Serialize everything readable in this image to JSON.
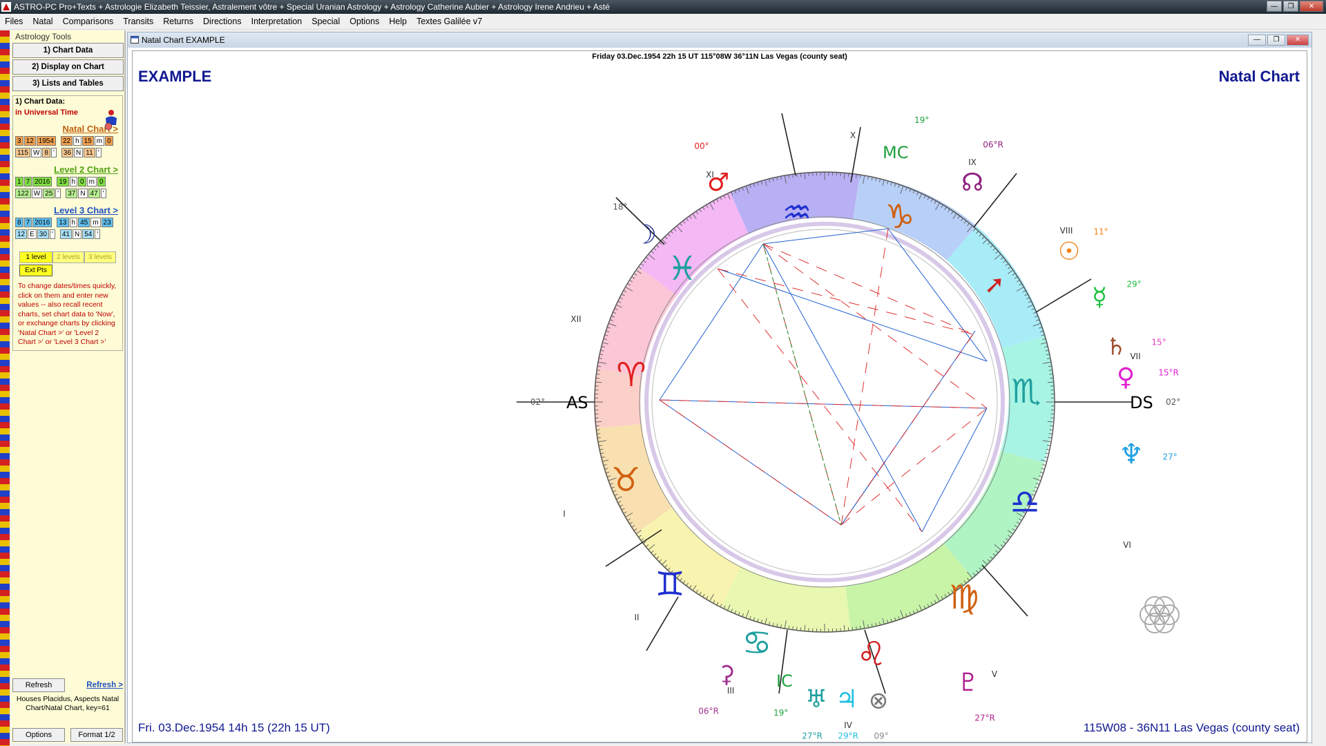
{
  "app": {
    "title": "ASTRO-PC Pro+Texts + Astrologie Elizabeth Teissier, Astralement vôtre + Special Uranian Astrology + Astrology Catherine Aubier + Astrology Irene Andrieu + Asté"
  },
  "menu": [
    "Files",
    "Natal",
    "Comparisons",
    "Transits",
    "Returns",
    "Directions",
    "Interpretation",
    "Special",
    "Options",
    "Help",
    "Textes Galilée v7"
  ],
  "sidebar": {
    "title": "Astrology Tools",
    "buttons": [
      "1) Chart Data",
      "2) Display on Chart",
      "3) Lists and Tables"
    ],
    "group_label": "1) Chart Data:",
    "ut_label": "in Universal Time",
    "natal": {
      "label": "Natal Chart >",
      "date": [
        "3",
        "12",
        "1954",
        "22",
        "h",
        "15",
        "m",
        "0"
      ],
      "coords": [
        "115",
        "W",
        "8",
        "'",
        "36",
        "N",
        "11",
        "'"
      ]
    },
    "level2": {
      "label": "Level 2 Chart >",
      "date": [
        "1",
        "7",
        "2016",
        "19",
        "h",
        "0",
        "m",
        "0"
      ],
      "coords": [
        "122",
        "W",
        "25",
        "'",
        "37",
        "N",
        "47",
        "'"
      ]
    },
    "level3": {
      "label": "Level 3 Chart >",
      "date": [
        "8",
        "7",
        "2016",
        "13",
        "h",
        "45",
        "m",
        "23"
      ],
      "coords": [
        "12",
        "E",
        "30",
        "'",
        "41",
        "N",
        "54",
        "'"
      ]
    },
    "level_buttons": [
      "1 level",
      "2 levels",
      "3 levels"
    ],
    "ext_pts": "Ext Pts",
    "help": "To change dates/times quickly, click on them and enter new values -- also recall recent charts, set chart data to 'Now', or exchange charts by clicking 'Natal Chart >' or 'Level 2 Chart >' or 'Level 3 Chart >'",
    "refresh": "Refresh",
    "refresh_link": "Refresh >",
    "info": "Houses Placidus, Aspects Natal Chart/Natal Chart, key=61",
    "options": "Options",
    "format": "Format 1/2"
  },
  "window": {
    "title": "Natal Chart  EXAMPLE"
  },
  "chart": {
    "header": "Friday 03.Dec.1954 22h 15 UT 115°08W 36°11N  Las Vegas (county seat)",
    "name": "EXAMPLE",
    "type_label": "Natal Chart",
    "footer_left": "Fri. 03.Dec.1954 14h 15 (22h 15 UT)",
    "footer_right": "115W08 - 36N11  Las Vegas (county seat)",
    "angles": {
      "as": "AS",
      "ds": "DS",
      "mc": "MC",
      "ic": "IC",
      "as_deg": "02°",
      "ds_deg": "02°",
      "mc_deg": "19°",
      "ic_deg": "19°"
    },
    "houses": [
      "I",
      "II",
      "III",
      "IV",
      "V",
      "VI",
      "VII",
      "VIII",
      "IX",
      "X",
      "XI",
      "XII"
    ],
    "planet_degrees": {
      "mars": "00°",
      "moon": "18°",
      "node": "06°R",
      "sun": "11°",
      "mercury": "29°",
      "saturn": "15°",
      "venus": "15°R",
      "neptune": "27°",
      "pluto": "27°R",
      "uranus": "27°R",
      "jupiter": "29°R",
      "fortune": "09°",
      "lilith": "06°R"
    }
  }
}
